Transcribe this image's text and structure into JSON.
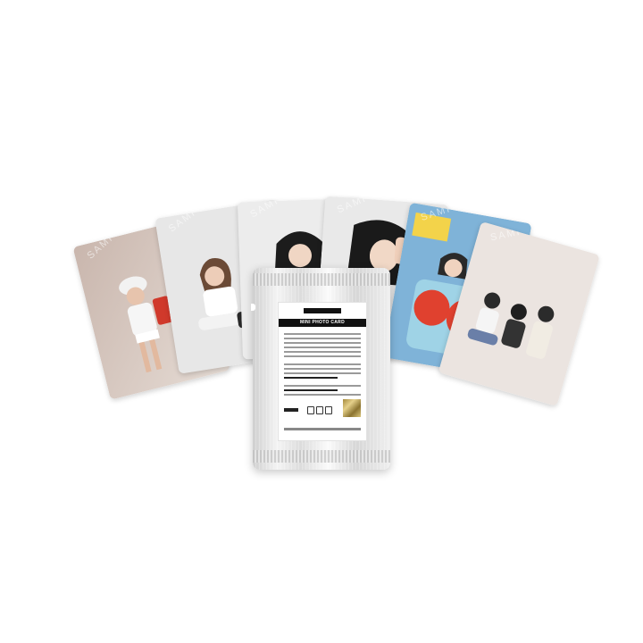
{
  "cards": [
    {
      "name": "card-1",
      "watermark": "SAMPLE"
    },
    {
      "name": "card-2",
      "watermark": "SAMPLE"
    },
    {
      "name": "card-3",
      "watermark": "SAMPLE"
    },
    {
      "name": "card-4",
      "watermark": "SAMPLE"
    },
    {
      "name": "card-5",
      "watermark": "SAMPLE"
    },
    {
      "name": "card-6",
      "watermark": "SAMPLE"
    }
  ],
  "pouch": {
    "label_title": "MINI PHOTO CARD"
  },
  "colors": {
    "background": "#ffffff",
    "pouch": "#e6e6e6",
    "label_bar": "#111111",
    "holo": "#c9b169"
  }
}
